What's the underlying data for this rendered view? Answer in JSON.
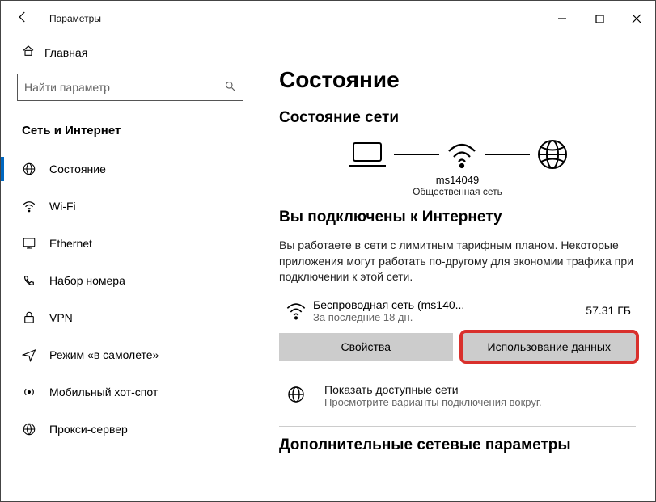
{
  "titlebar": {
    "title": "Параметры"
  },
  "sidebar": {
    "home": "Главная",
    "search_placeholder": "Найти параметр",
    "section": "Сеть и Интернет",
    "items": [
      {
        "label": "Состояние"
      },
      {
        "label": "Wi-Fi"
      },
      {
        "label": "Ethernet"
      },
      {
        "label": "Набор номера"
      },
      {
        "label": "VPN"
      },
      {
        "label": "Режим «в самолете»"
      },
      {
        "label": "Мобильный хот-спот"
      },
      {
        "label": "Прокси-сервер"
      }
    ]
  },
  "main": {
    "page_title": "Состояние",
    "net_status_heading": "Состояние сети",
    "diagram_ssid": "ms14049",
    "diagram_nettype": "Общественная сеть",
    "connected_heading": "Вы подключены к Интернету",
    "connected_text": "Вы работаете в сети с лимитным тарифным планом. Некоторые приложения могут работать по-другому для экономии трафика при подключении к этой сети.",
    "connection_name": "Беспроводная сеть (ms140...",
    "connection_sub": "За последние 18 дн.",
    "connection_usage": "57.31 ГБ",
    "btn_properties": "Свойства",
    "btn_datausage": "Использование данных",
    "available_title": "Показать доступные сети",
    "available_sub": "Просмотрите варианты подключения вокруг.",
    "additional_heading": "Дополнительные сетевые параметры"
  }
}
